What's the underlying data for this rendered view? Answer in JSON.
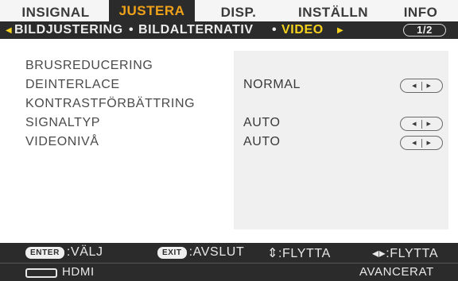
{
  "tabs": [
    "INSIGNAL",
    "JUSTERA",
    "DISP.",
    "INSTÄLLN",
    "INFO"
  ],
  "active_tab": "JUSTERA",
  "subnav": {
    "items": [
      "BILDJUSTERING",
      "BILDALTERNATIV",
      "VIDEO"
    ],
    "separator": "•",
    "active": "VIDEO",
    "page": "1/2"
  },
  "menu": [
    {
      "label": "BRUSREDUCERING",
      "value": ""
    },
    {
      "label": "DEINTERLACE",
      "value": "NORMAL"
    },
    {
      "label": "KONTRASTFÖRBÄTTRING",
      "value": ""
    },
    {
      "label": "SIGNALTYP",
      "value": "AUTO"
    },
    {
      "label": "VIDEONIVÅ",
      "value": "AUTO"
    }
  ],
  "footer": {
    "enter_key": "ENTER",
    "enter_label": ":VÄLJ",
    "exit_key": "EXIT",
    "exit_label": ":AVSLUT",
    "updown_label": "⇕:FLYTTA",
    "leftright_label": "◂▸:FLYTTA",
    "source": "HDMI",
    "mode": "AVANCERAT"
  },
  "colors": {
    "bar": "#2b2b2b",
    "active_tab_text": "#f0a21a",
    "active_sub_text": "#f5d21e"
  }
}
